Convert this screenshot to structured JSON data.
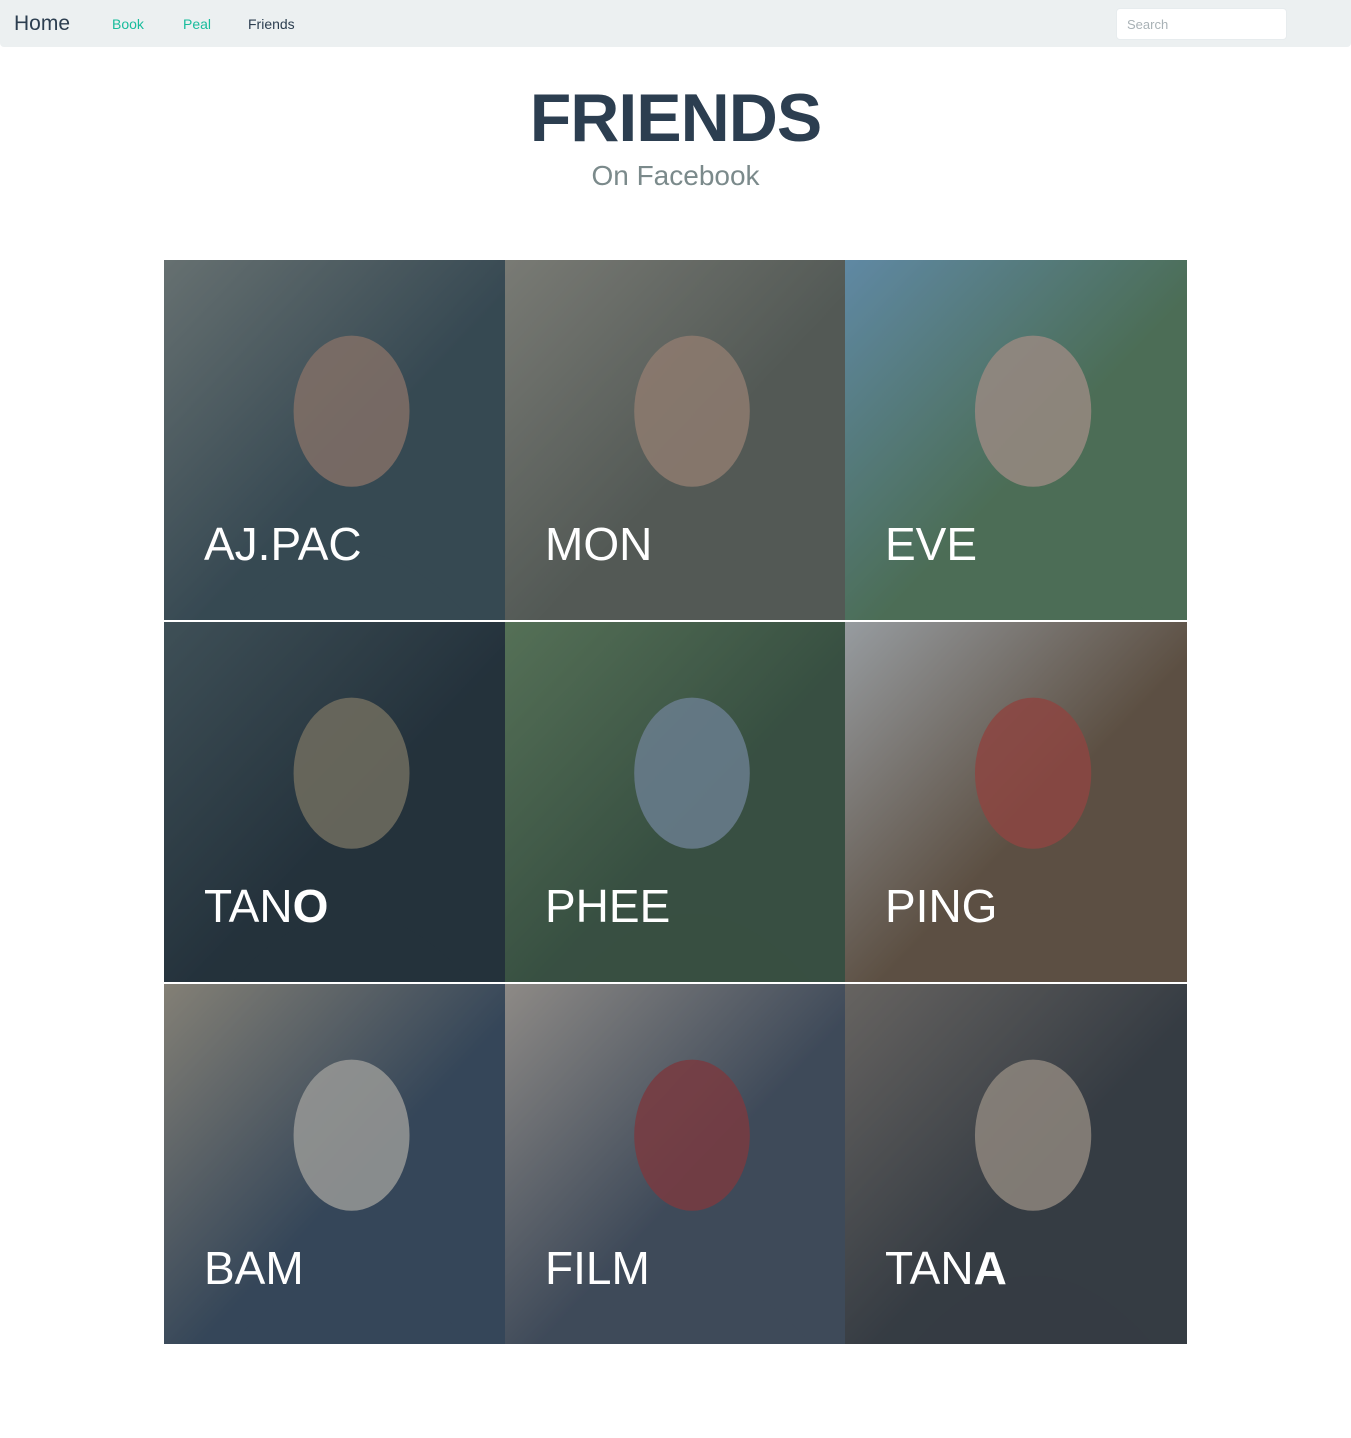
{
  "navbar": {
    "brand": "Home",
    "links": [
      {
        "label": "Book",
        "color": "#18bc9c"
      },
      {
        "label": "Peal",
        "color": "#18bc9c"
      },
      {
        "label": "Friends",
        "color": "#2c3e50"
      }
    ],
    "search_placeholder": "Search"
  },
  "header": {
    "title": "FRIENDS",
    "subtitle": "On Facebook"
  },
  "friends": [
    {
      "name_light": "AJ.PAC",
      "name_bold": "",
      "photo_colors": [
        "#3d4f55",
        "#8a8f86",
        "#b58d75"
      ]
    },
    {
      "name_light": "MON",
      "name_bold": "",
      "photo_colors": [
        "#6b6a5a",
        "#a89f8c",
        "#c9a084"
      ]
    },
    {
      "name_light": "EVE",
      "name_bold": "",
      "photo_colors": [
        "#5f8a5b",
        "#7fb6d8",
        "#d9b6a0"
      ]
    },
    {
      "name_light": "TAN",
      "name_bold": "O",
      "photo_colors": [
        "#1f2a30",
        "#4a5a5c",
        "#9a8a6a"
      ]
    },
    {
      "name_light": "PHEE",
      "name_bold": "",
      "photo_colors": [
        "#3f5a3a",
        "#6e8f5c",
        "#8fa3b5"
      ]
    },
    {
      "name_light": "PING",
      "name_bold": "",
      "photo_colors": [
        "#7a5a3c",
        "#d8d5d2",
        "#c74a3a"
      ]
    },
    {
      "name_light": "BAM",
      "name_bold": "",
      "photo_colors": [
        "#3b4b5f",
        "#b9a88e",
        "#d9cfc2"
      ]
    },
    {
      "name_light": "FILM",
      "name_bold": "",
      "photo_colors": [
        "#4a5160",
        "#c9b8a8",
        "#a83838"
      ]
    },
    {
      "name_light": "TAN",
      "name_bold": "A",
      "photo_colors": [
        "#3b3a3c",
        "#8a7a6c",
        "#c9b19a"
      ]
    }
  ]
}
